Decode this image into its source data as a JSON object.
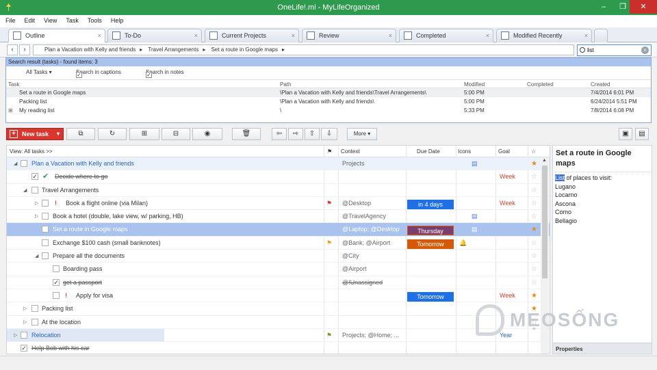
{
  "window": {
    "title": "OneLife!.ml - MyLifeOrganized",
    "min": "–",
    "max": "❐",
    "close": "✕"
  },
  "menu": [
    "File",
    "Edit",
    "View",
    "Task",
    "Tools",
    "Help"
  ],
  "tabs": [
    {
      "label": "Outline",
      "active": true
    },
    {
      "label": "To-Do"
    },
    {
      "label": "Current Projects"
    },
    {
      "label": "Review"
    },
    {
      "label": "Completed"
    },
    {
      "label": "Modified Recently"
    }
  ],
  "breadcrumb": [
    "Plan a Vacation with Kelly and friends",
    "Travel Arrangements",
    "Set a route in Google maps"
  ],
  "search": {
    "value": "list"
  },
  "results": {
    "header": "Search result (tasks) - found items: 3",
    "filter": "All Tasks",
    "opt_captions": "Search in captions",
    "opt_notes": "Search in notes",
    "columns": {
      "task": "Task",
      "path": "Path",
      "modified": "Modified",
      "completed": "Completed",
      "created": "Created"
    },
    "rows": [
      {
        "task": "Set a route in Google maps",
        "path": "\\Plan a Vacation with Kelly and friends\\Travel Arrangements\\",
        "modified": "5:00 PM",
        "completed": "",
        "created": "7/4/2014 6:01 PM"
      },
      {
        "task": "Packing list",
        "path": "\\Plan a Vacation with Kelly and friends\\",
        "modified": "5:00 PM",
        "completed": "",
        "created": "6/24/2014 5:51 PM"
      },
      {
        "task": "My reading list",
        "path": "\\",
        "modified": "5:33 PM",
        "completed": "",
        "created": "7/8/2014 6:08 PM"
      }
    ]
  },
  "toolbar": {
    "new_task": "New task",
    "more": "More"
  },
  "outline": {
    "view_label": "View: All tasks >>",
    "columns": {
      "context": "Context",
      "due": "Due Date",
      "icons": "Icons",
      "goal": "Goal"
    },
    "rows": [
      {
        "title": "Plan a Vacation with Kelly and friends",
        "context": "Projects",
        "due": "",
        "goal": ""
      },
      {
        "title": "Decide where to go",
        "context": "",
        "due": "",
        "goal": "Week"
      },
      {
        "title": "Travel Arrangements",
        "context": "",
        "due": "",
        "goal": ""
      },
      {
        "title": "Book a flight online (via Milan)",
        "context": "@Desktop",
        "due": "in 4 days",
        "goal": "Week"
      },
      {
        "title": "Book a hotel (double, lake view, w/ parking, HB)",
        "context": "@TravelAgency",
        "due": "",
        "goal": ""
      },
      {
        "title": "Set a route in Google maps",
        "context": "@Laptop; @Desktop",
        "due": "Thursday",
        "goal": ""
      },
      {
        "title": "Exchange $100 cash (small banknotes)",
        "context": "@Bank; @Airport",
        "due": "Tomorrow",
        "goal": ""
      },
      {
        "title": "Prepare all the documents",
        "context": "@City",
        "due": "",
        "goal": ""
      },
      {
        "title": "Boarding pass",
        "context": "@Airport",
        "due": "",
        "goal": ""
      },
      {
        "title": "get a passport",
        "context": "@!Unassigned",
        "due": "",
        "goal": ""
      },
      {
        "title": "Apply for visa",
        "context": "",
        "due": "Tomorrow",
        "goal": "Week"
      },
      {
        "title": "Packing list",
        "context": "",
        "due": "",
        "goal": ""
      },
      {
        "title": "At the location",
        "context": "",
        "due": "",
        "goal": ""
      },
      {
        "title": "Relocation",
        "context": "Projects; @Home; ...",
        "due": "",
        "goal": "Year"
      },
      {
        "title": "Help Bob with his car",
        "context": "",
        "due": "",
        "goal": ""
      }
    ]
  },
  "notes": {
    "title": "Set a route in Google maps",
    "highlight": "List",
    "first_line_rest": " of places to visit:",
    "lines": [
      "Lugano",
      "Locarno",
      "Ascona",
      "Como",
      "Bellagio"
    ],
    "properties": "Properties"
  },
  "watermark": "MẸOSỐNG",
  "colors": {
    "titlebar": "#2e9a4e",
    "selection": "#a9c3ee",
    "due_blue": "#1f6fe5",
    "due_purple": "#7a3f6f",
    "due_orange": "#d45a0a",
    "goal": "#d04030"
  }
}
